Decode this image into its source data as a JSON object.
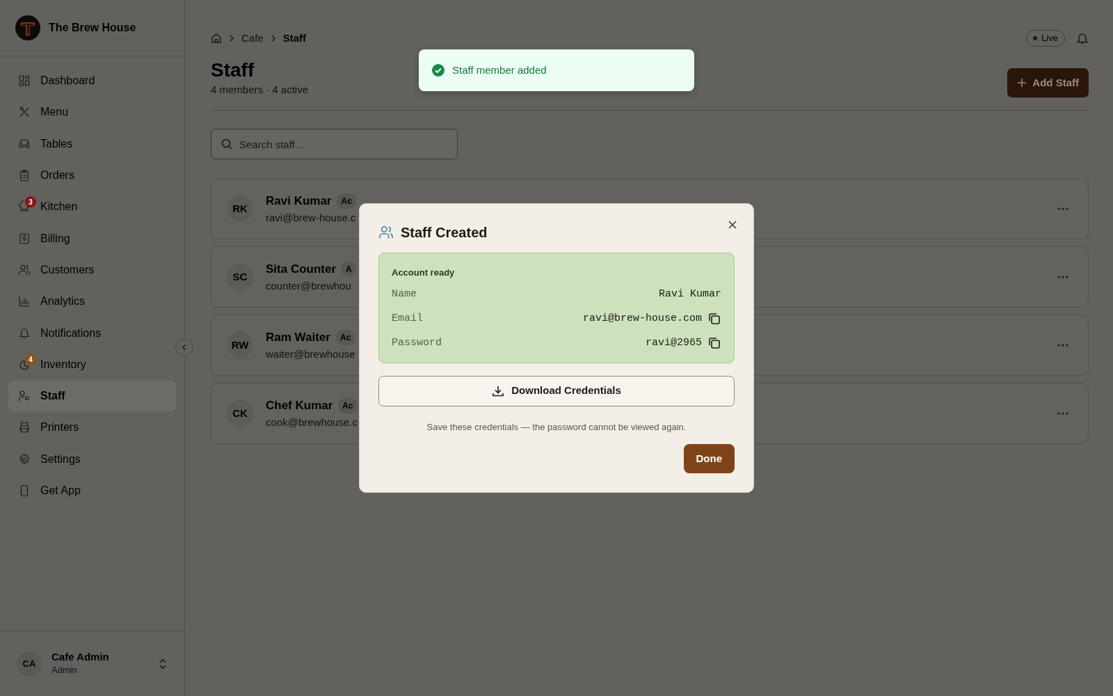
{
  "sidebar": {
    "brand": "The Brew House",
    "items": [
      {
        "label": "Dashboard",
        "selected": false
      },
      {
        "label": "Menu",
        "selected": false
      },
      {
        "label": "Tables",
        "selected": false
      },
      {
        "label": "Orders",
        "selected": false
      },
      {
        "label": "Kitchen",
        "selected": false,
        "badge": "3",
        "color": "#8a1515"
      },
      {
        "label": "Billing",
        "selected": false
      },
      {
        "label": "Customers",
        "selected": false
      },
      {
        "label": "Analytics",
        "selected": false
      },
      {
        "label": "Notifications",
        "selected": false
      },
      {
        "label": "Inventory",
        "selected": false,
        "badge": "4",
        "color": "#8a5418"
      },
      {
        "label": "Staff",
        "selected": true
      },
      {
        "label": "Printers",
        "selected": false
      },
      {
        "label": "Settings",
        "selected": false
      },
      {
        "label": "Get App",
        "selected": false
      }
    ],
    "user": {
      "initials": "CA",
      "name": "Cafe Admin",
      "role": "Admin"
    }
  },
  "breadcrumb": [
    "Cafe",
    "Staff"
  ],
  "live": "Live",
  "page": {
    "title": "Staff",
    "subtitle": "4 members · 4 active",
    "add_button": "Add Staff",
    "search": {
      "placeholder": "Search staff..."
    }
  },
  "staff": [
    {
      "initials": "RK",
      "name": "Ravi Kumar",
      "badge": "Ac",
      "email": "ravi@brew-house.c"
    },
    {
      "initials": "SC",
      "name": "Sita Counter",
      "badge": "A",
      "email": "counter@brewhou"
    },
    {
      "initials": "RW",
      "name": "Ram Waiter",
      "badge": "Ac",
      "email": "waiter@brewhouse"
    },
    {
      "initials": "CK",
      "name": "Chef Kumar",
      "badge": "Ac",
      "email": "cook@brewhouse.c"
    }
  ],
  "toast": {
    "message": "Staff member added"
  },
  "dialog": {
    "title": "Staff Created",
    "section_title": "Account ready",
    "fields": [
      {
        "label": "Name",
        "value": "Ravi Kumar",
        "copyable": false
      },
      {
        "label": "Email",
        "value": "ravi@brew-house.com",
        "copyable": true
      },
      {
        "label": "Password",
        "value": "ravi@2965",
        "copyable": true
      }
    ],
    "download": "Download Credentials",
    "note": "Save these credentials — the password cannot be viewed again.",
    "done": "Done"
  }
}
